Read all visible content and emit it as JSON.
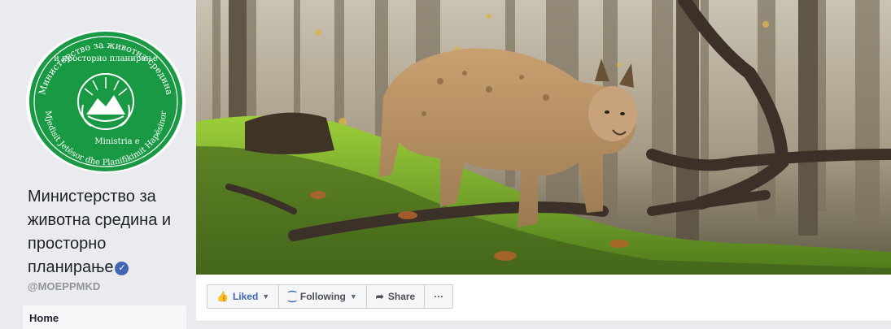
{
  "profile": {
    "logo_text_top": "Министерство за животна средина и просторно планирање",
    "logo_text_bottom": "Ministria e Mjedisit Jetësor dhe Planifikimit Hapësinor",
    "brand_color": "#1a9944"
  },
  "page": {
    "name": "Министерство за животна средина и просторно планирање",
    "handle": "@MOEPPMKD",
    "verified_icon": "verified-badge-icon"
  },
  "nav": {
    "home_label": "Home"
  },
  "actions": {
    "liked_label": "Liked",
    "following_label": "Following",
    "share_label": "Share",
    "more_label": "···"
  }
}
